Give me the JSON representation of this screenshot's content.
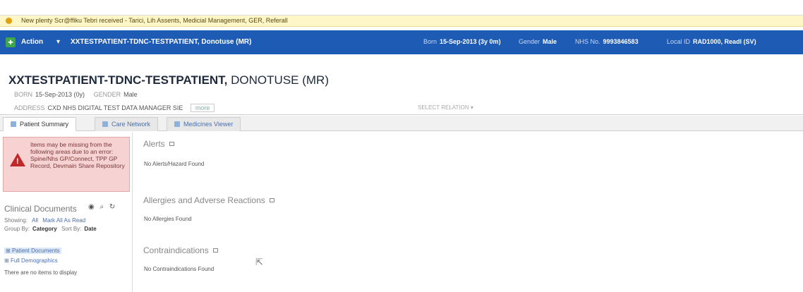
{
  "alert": {
    "message": "New plenty Scr@ffiku Tebri received - Tarici, Lih Assents, Medicial Management, GER, Referall"
  },
  "banner": {
    "action_label": "Action",
    "patient_name": "XXTESTPATIENT-TDNC-TESTPATIENT, Donotuse (MR)",
    "born_label": "Born",
    "born_value": "15-Sep-2013 (3y 0m)",
    "gender_label": "Gender",
    "gender_value": "Male",
    "nhs_label": "NHS No.",
    "nhs_value": "9993846583",
    "local_label": "Local ID",
    "local_value": "RAD1000, ReadI (SV)"
  },
  "header": {
    "name_bold": "XXTESTPATIENT-TDNC-TESTPATIENT,",
    "name_rest": "DONOTUSE (MR)",
    "born_label": "BORN",
    "born_value": "15-Sep-2013 (0y)",
    "gender_label": "GENDER",
    "gender_value": "Male",
    "address_label": "ADDRESS",
    "address_value": "CXD NHS DIGITAL TEST DATA MANAGER SIE",
    "address_link": "more",
    "select_relation": "SELECT RELATION"
  },
  "tabs": [
    {
      "label": "Patient Summary"
    },
    {
      "label": "Care Network"
    },
    {
      "label": "Medicines Viewer"
    }
  ],
  "left": {
    "error_text": "Items may be missing from the following areas due to an error: Spine/Nhs GP/Connect, TPP GP Record, Devmain Share Repository",
    "clinical_title": "Clinical Documents",
    "showing_label": "Showing:",
    "showing_all": "All",
    "showing_mark": "Mark All As Read",
    "group_label": "Group By:",
    "group_value": "Category",
    "sort_label": "Sort By:",
    "sort_value": "Date",
    "items": [
      "Patient Documents",
      "Full Demographics"
    ],
    "empty_text": "There are no items to display"
  },
  "sections": [
    {
      "title": "Alerts",
      "empty": "No Alerts/Hazard Found"
    },
    {
      "title": "Allergies and Adverse Reactions",
      "empty": "No Allergies Found"
    },
    {
      "title": "Contraindications",
      "empty": "No Contraindications Found"
    }
  ],
  "colors": {
    "banner": "#1d5bb5",
    "alert_bg": "#fff6c8",
    "error_bg": "#f6d2d2",
    "error_icon": "#c0282a"
  },
  "icons": [
    "warning-icon",
    "app-logo-icon",
    "eye-icon",
    "search-icon",
    "refresh-icon",
    "collapse-icon",
    "cursor-icon"
  ]
}
